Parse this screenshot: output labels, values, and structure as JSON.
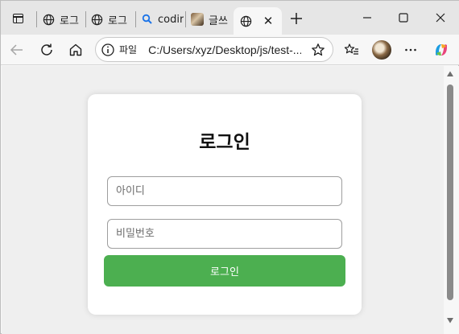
{
  "browser": {
    "tabs": [
      {
        "label": "로그",
        "favicon": "globe-icon"
      },
      {
        "label": "로그",
        "favicon": "globe-icon"
      },
      {
        "label": "codir",
        "favicon": "search-icon"
      },
      {
        "label": "글쓰",
        "favicon": "profile-photo-icon"
      },
      {
        "label": "",
        "favicon": "globe-icon",
        "active": true
      }
    ],
    "address": {
      "scheme_label": "파일",
      "url": "C:/Users/xyz/Desktop/js/test-..."
    },
    "accent_color": "#0078d4"
  },
  "login": {
    "title": "로그인",
    "id_placeholder": "아이디",
    "pw_placeholder": "비밀번호",
    "submit_label": "로그인",
    "button_color": "#4caf50"
  }
}
